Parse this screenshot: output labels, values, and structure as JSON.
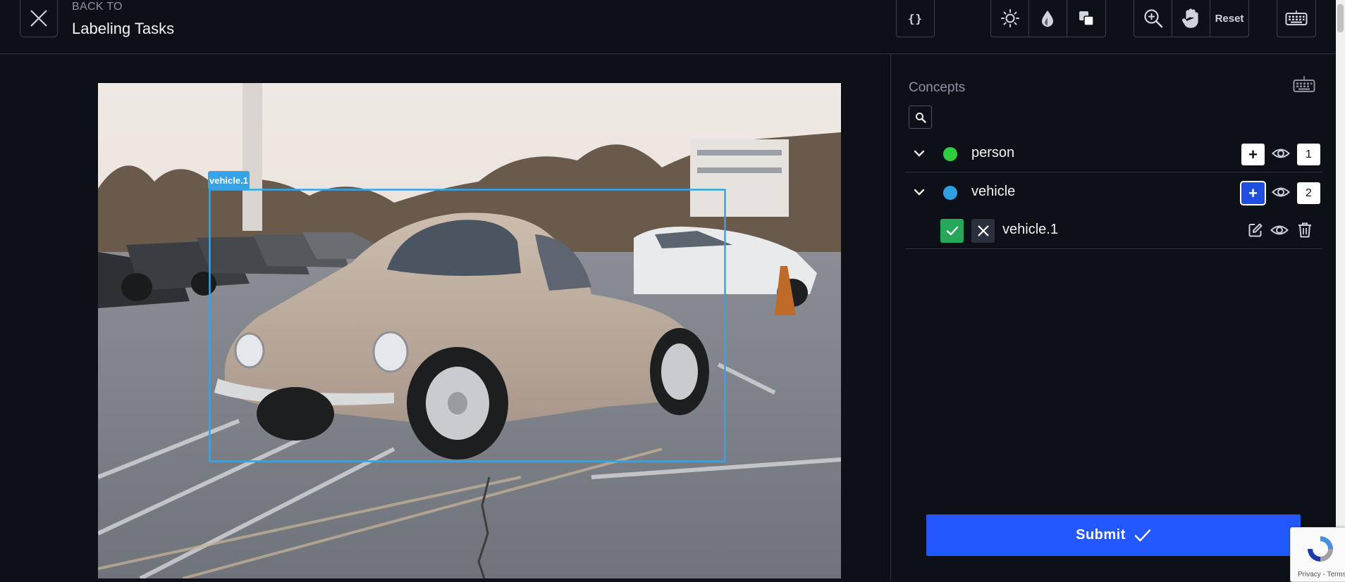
{
  "header": {
    "back_small": "BACK TO",
    "back_title": "Labeling Tasks",
    "reset_label": "Reset",
    "json_label": "{}"
  },
  "icons": {
    "close": "close-icon",
    "json": "code-braces-icon",
    "brightness": "sun-icon",
    "saturation": "droplet-icon",
    "contrast": "contrast-squares-icon",
    "zoom": "zoom-in-icon",
    "pan": "hand-icon",
    "keyboard": "keyboard-icon"
  },
  "canvas": {
    "annotation_label": "vehicle.1",
    "box_color": "#35a3e5"
  },
  "panel": {
    "title": "Concepts",
    "concepts": [
      {
        "label": "person",
        "color": "#2ecc40",
        "count": "1",
        "add_active": false
      },
      {
        "label": "vehicle",
        "color": "#2e9fe0",
        "count": "2",
        "add_active": true
      }
    ],
    "instances": [
      {
        "label": "vehicle.1"
      }
    ],
    "submit_label": "Submit"
  },
  "recaptcha": {
    "text": "Privacy - Terms"
  },
  "colors": {
    "background": "#0d1117",
    "accent": "#2458ff",
    "approve": "#27a75a"
  }
}
